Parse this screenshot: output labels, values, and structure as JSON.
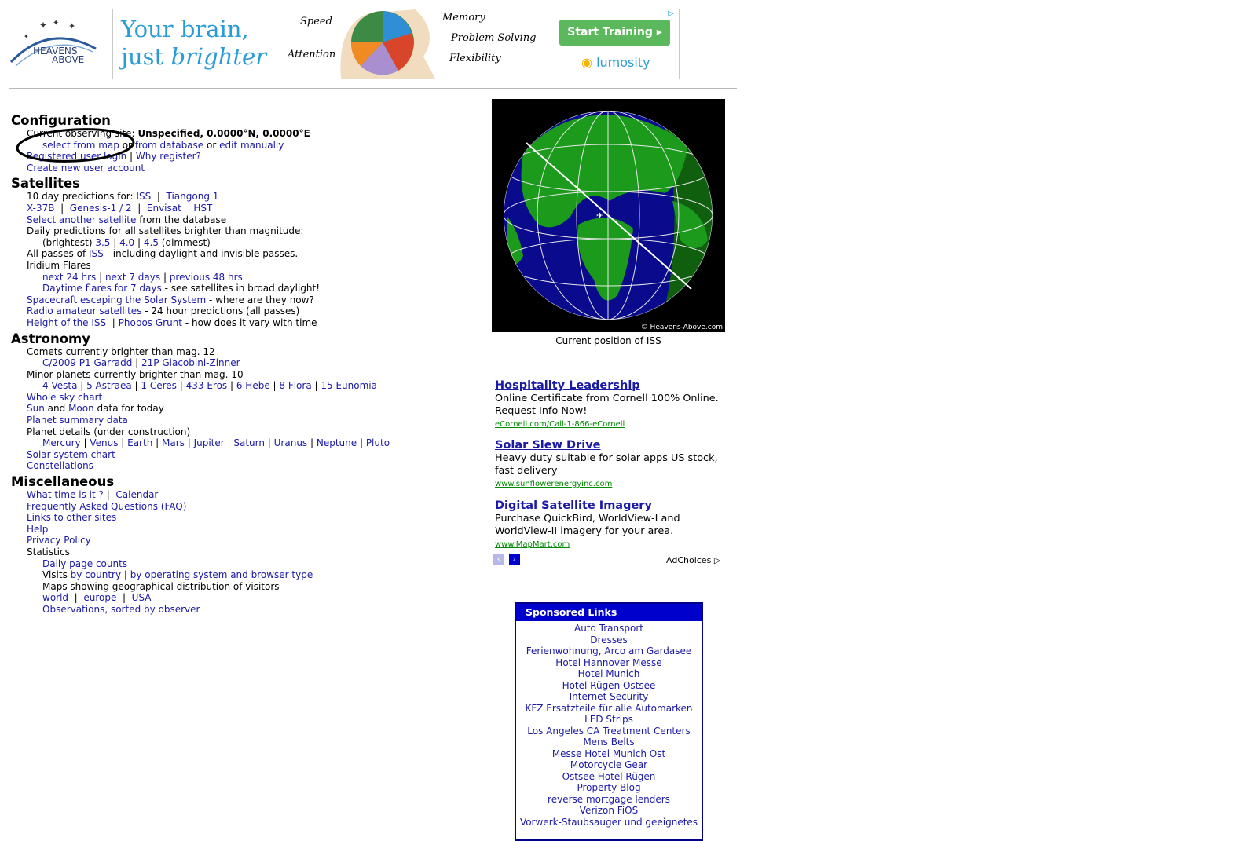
{
  "logo": {
    "line1": "HEAVENS",
    "line2": "ABOVE"
  },
  "banner": {
    "headline1": "Your brain,",
    "headline2": "just",
    "headline2_em": "brighter",
    "labels": [
      "Speed",
      "Memory",
      "Attention",
      "Problem Solving",
      "Flexibility"
    ],
    "cta": "Start Training",
    "brand": "lumosity",
    "colors": {
      "cta_bg": "#5cb85c",
      "headline": "#2b9bd6"
    }
  },
  "config": {
    "heading": "Configuration",
    "site_prefix": "Current observing site:",
    "site_value": "Unspecified, 0.0000°N, 0.0000°E",
    "select_map": "select from map",
    "or1": "or",
    "from_db": "from database",
    "or2": "or",
    "edit_manually": "edit manually",
    "registered_login": "Registered user login",
    "why_register": "Why register?",
    "create_account": "Create new user account"
  },
  "satellites": {
    "heading": "Satellites",
    "pred_prefix": "10 day predictions for:",
    "iss": "ISS",
    "tiangong": "Tiangong 1",
    "x37b": "X-37B",
    "genesis": "Genesis-1 / 2",
    "envisat": "Envisat",
    "hst": "HST",
    "select_another": "Select another satellite",
    "from_the_db": "from the database",
    "daily_pred": "Daily predictions for all satellites brighter than magnitude:",
    "brightest": "(brightest)",
    "m35": "3.5",
    "m40": "4.0",
    "m45": "4.5",
    "dimmest": "(dimmest)",
    "all_passes_prefix": "All passes of",
    "all_passes_iss": "ISS",
    "all_passes_suffix": "- including daylight and invisible passes.",
    "iridium": "Iridium Flares",
    "next24": "next 24 hrs",
    "next7": "next 7 days",
    "prev48": "previous 48 hrs",
    "daytime_flares": "Daytime flares for 7 days",
    "daytime_suffix": "- see satellites in broad daylight!",
    "spacecraft": "Spacecraft escaping the Solar System",
    "spacecraft_suffix": "- where are they now?",
    "radio": "Radio amateur satellites",
    "radio_suffix": "- 24 hour predictions (all passes)",
    "height_iss": "Height of the ISS",
    "phobos": "Phobos Grunt",
    "height_suffix": "- how does it vary with time"
  },
  "astronomy": {
    "heading": "Astronomy",
    "comets": "Comets currently brighter than mag. 12",
    "comet1": "C/2009 P1 Garradd",
    "comet2": "21P Giacobini-Zinner",
    "minor": "Minor planets currently brighter than mag. 10",
    "minor_list": [
      "4 Vesta",
      "5 Astraea",
      "1 Ceres",
      "433 Eros",
      "6 Hebe",
      "8 Flora",
      "15 Eunomia"
    ],
    "whole_sky": "Whole sky chart",
    "sun": "Sun",
    "and": "and",
    "moon": "Moon",
    "data_today": "data for today",
    "planet_summary": "Planet summary data",
    "planet_details": "Planet details (under construction)",
    "planets": [
      "Mercury",
      "Venus",
      "Earth",
      "Mars",
      "Jupiter",
      "Saturn",
      "Uranus",
      "Neptune",
      "Pluto"
    ],
    "solar_chart": "Solar system chart",
    "constellations": "Constellations"
  },
  "misc": {
    "heading": "Miscellaneous",
    "what_time": "What time is it ?",
    "calendar": "Calendar",
    "faq": "Frequently Asked Questions (FAQ)",
    "links": "Links to other sites",
    "help": "Help",
    "privacy": "Privacy Policy",
    "statistics": "Statistics",
    "daily_counts": "Daily page counts",
    "visits": "Visits",
    "by_country": "by country",
    "by_os": "by operating system and browser type",
    "maps_text": "Maps showing geographical distribution of visitors",
    "world": "world",
    "europe": "europe",
    "usa": "USA",
    "observations": "Observations, sorted by observer"
  },
  "globe": {
    "caption": "Current position of ISS",
    "copyright": "© Heavens-Above.com"
  },
  "ads": [
    {
      "title": "Hospitality Leadership",
      "desc": "Online Certificate from Cornell 100% Online. Request Info Now!",
      "url": "eCornell.com/Call-1-866-eCornell"
    },
    {
      "title": "Solar Slew Drive",
      "desc": "Heavy duty suitable for solar apps US stock, fast delivery",
      "url": "www.sunflowerenergyinc.com"
    },
    {
      "title": "Digital Satellite Imagery",
      "desc": "Purchase QuickBird, WorldView-I and WorldView-II imagery for your area.",
      "url": "www.MapMart.com"
    }
  ],
  "adchoices": "AdChoices",
  "sponsored": {
    "title": "Sponsored Links",
    "items": [
      "Auto Transport",
      "Dresses",
      "Ferienwohnung, Arco am Gardasee",
      "Hotel Hannover Messe",
      "Hotel Munich",
      "Hotel Rügen Ostsee",
      "Internet Security",
      "KFZ Ersatzteile für alle Automarken",
      "LED Strips",
      "Los Angeles CA Treatment Centers",
      "Mens Belts",
      "Messe Hotel Munich Ost",
      "Motorcycle Gear",
      "Ostsee Hotel Rügen",
      "Property Blog",
      "reverse mortgage lenders",
      "Verizon FiOS",
      "Vorwerk-Staubsauger und geeignetes"
    ]
  }
}
